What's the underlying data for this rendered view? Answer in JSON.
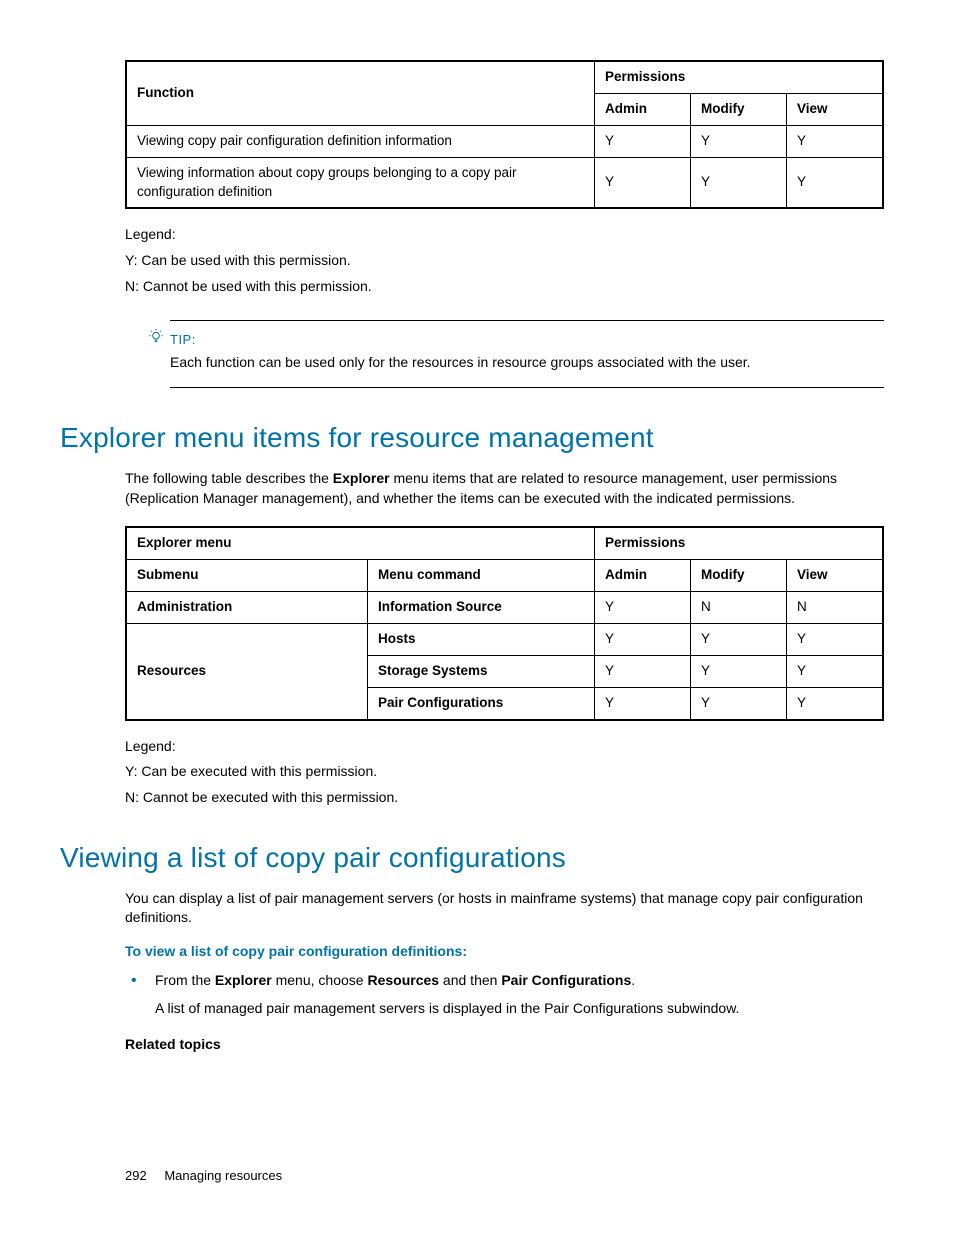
{
  "table1": {
    "header_function": "Function",
    "header_permissions": "Permissions",
    "header_admin": "Admin",
    "header_modify": "Modify",
    "header_view": "View",
    "rows": [
      {
        "fn": "Viewing copy pair configuration definition information",
        "admin": "Y",
        "modify": "Y",
        "view": "Y"
      },
      {
        "fn": "Viewing information about copy groups belonging to a copy pair configuration definition",
        "admin": "Y",
        "modify": "Y",
        "view": "Y"
      }
    ]
  },
  "legend1": {
    "title": "Legend:",
    "y": "Y: Can be used with this permission.",
    "n": "N: Cannot be used with this permission."
  },
  "tip": {
    "label": "TIP:",
    "text": "Each function can be used only for the resources in resource groups associated with the user."
  },
  "section2": {
    "heading": "Explorer menu items for resource management",
    "intro_pre": "The following table describes the ",
    "intro_bold": "Explorer",
    "intro_post": " menu items that are related to resource management, user permissions (Replication Manager management), and whether the items can be executed with the indicated permissions."
  },
  "table2": {
    "header_explorer": "Explorer menu",
    "header_permissions": "Permissions",
    "header_submenu": "Submenu",
    "header_command": "Menu command",
    "header_admin": "Admin",
    "header_modify": "Modify",
    "header_view": "View",
    "rows": [
      {
        "submenu": "Administration",
        "command": "Information Source",
        "admin": "Y",
        "modify": "N",
        "view": "N"
      },
      {
        "submenu": "Resources",
        "command": "Hosts",
        "admin": "Y",
        "modify": "Y",
        "view": "Y"
      },
      {
        "submenu": "",
        "command": "Storage Systems",
        "admin": "Y",
        "modify": "Y",
        "view": "Y"
      },
      {
        "submenu": "",
        "command": "Pair Configurations",
        "admin": "Y",
        "modify": "Y",
        "view": "Y"
      }
    ]
  },
  "legend2": {
    "title": "Legend:",
    "y": "Y: Can be executed with this permission.",
    "n": "N: Cannot be executed with this permission."
  },
  "section3": {
    "heading": "Viewing a list of copy pair configurations",
    "intro": "You can display a list of pair management servers (or hosts in mainframe systems) that manage copy pair configuration definitions.",
    "sub_heading": "To view a list of copy pair configuration definitions:",
    "bullet_pre": "From the ",
    "bullet_b1": "Explorer",
    "bullet_mid1": " menu, choose ",
    "bullet_b2": "Resources",
    "bullet_mid2": " and then ",
    "bullet_b3": "Pair Configurations",
    "bullet_post": ".",
    "bullet_result": "A list of managed pair management servers is displayed in the Pair Configurations subwindow.",
    "related": "Related topics"
  },
  "footer": {
    "page": "292",
    "title": "Managing resources"
  }
}
